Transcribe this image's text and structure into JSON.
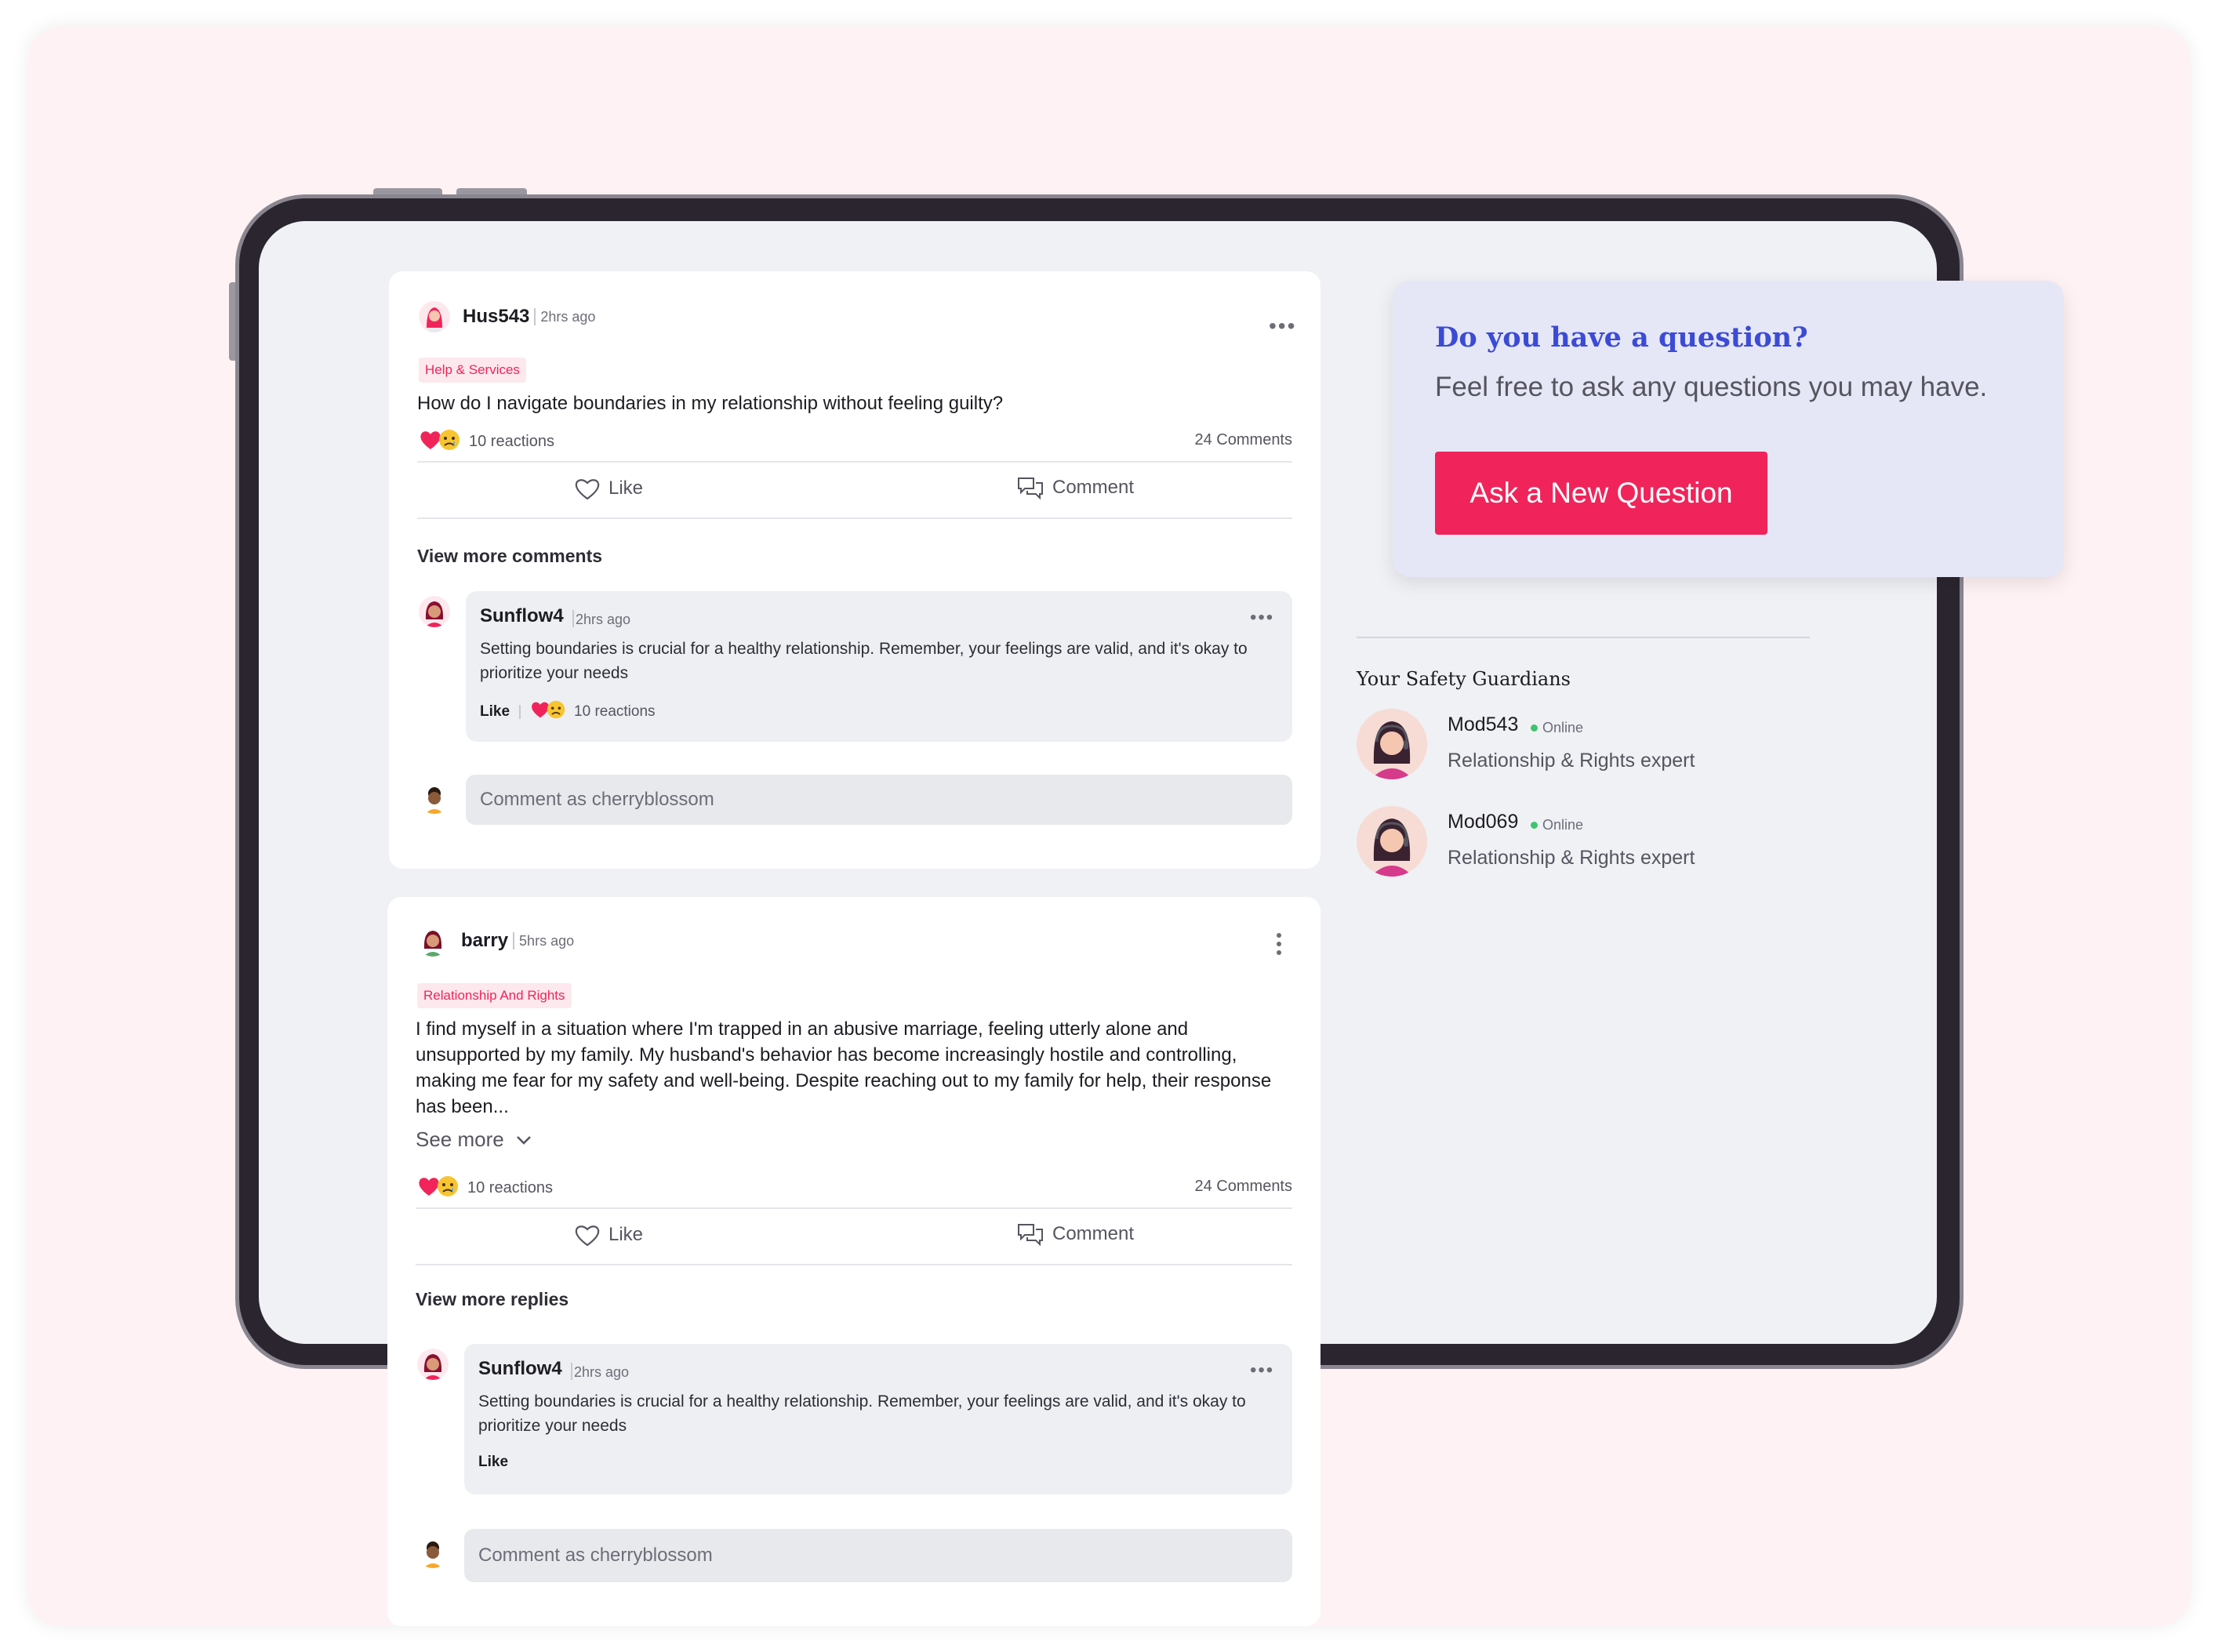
{
  "posts": [
    {
      "username": "Hus543",
      "time": "2hrs ago",
      "tag": "Help & Services",
      "text": "How do I navigate boundaries in my relationship without feeling guilty?",
      "reactions": "10 reactions",
      "comments": "24 Comments",
      "like_label": "Like",
      "comment_label": "Comment",
      "view_more": "View more comments",
      "reply": {
        "username": "Sunflow4",
        "time": "2hrs ago",
        "text": "Setting boundaries is crucial for a healthy relationship. Remember, your feelings are valid, and it's okay to prioritize your needs",
        "like_label": "Like",
        "reactions": "10 reactions"
      },
      "comment_placeholder": "Comment as cherryblossom"
    },
    {
      "username": "barry",
      "time": "5hrs ago",
      "tag": "Relationship And Rights",
      "text": "I find myself in a situation where I'm trapped in an abusive marriage, feeling utterly alone and unsupported by my family. My husband's behavior has become increasingly hostile and controlling, making me fear for my safety and well-being. Despite reaching out to my family for help, their response has been...",
      "see_more": "See more",
      "reactions": "10 reactions",
      "comments": "24 Comments",
      "like_label": "Like",
      "comment_label": "Comment",
      "view_more": "View more replies",
      "reply": {
        "username": "Sunflow4",
        "time": "2hrs ago",
        "text": "Setting boundaries is crucial for a healthy relationship. Remember, your feelings are valid, and it's okay to prioritize your needs",
        "like_label": "Like"
      },
      "comment_placeholder": "Comment as cherryblossom"
    }
  ],
  "ask": {
    "title": "Do you have a question?",
    "subtitle": "Feel free to ask any questions you may have.",
    "button": "Ask a New Question"
  },
  "guardians": {
    "title": "Your Safety Guardians",
    "items": [
      {
        "name": "Mod543",
        "status": "Online",
        "role": "Relationship & Rights expert"
      },
      {
        "name": "Mod069",
        "status": "Online",
        "role": "Relationship & Rights expert"
      }
    ]
  },
  "colors": {
    "accent": "#f0245a",
    "title_blue": "#3b4bd6",
    "online": "#3ec46d",
    "background": "#fff2f4"
  }
}
